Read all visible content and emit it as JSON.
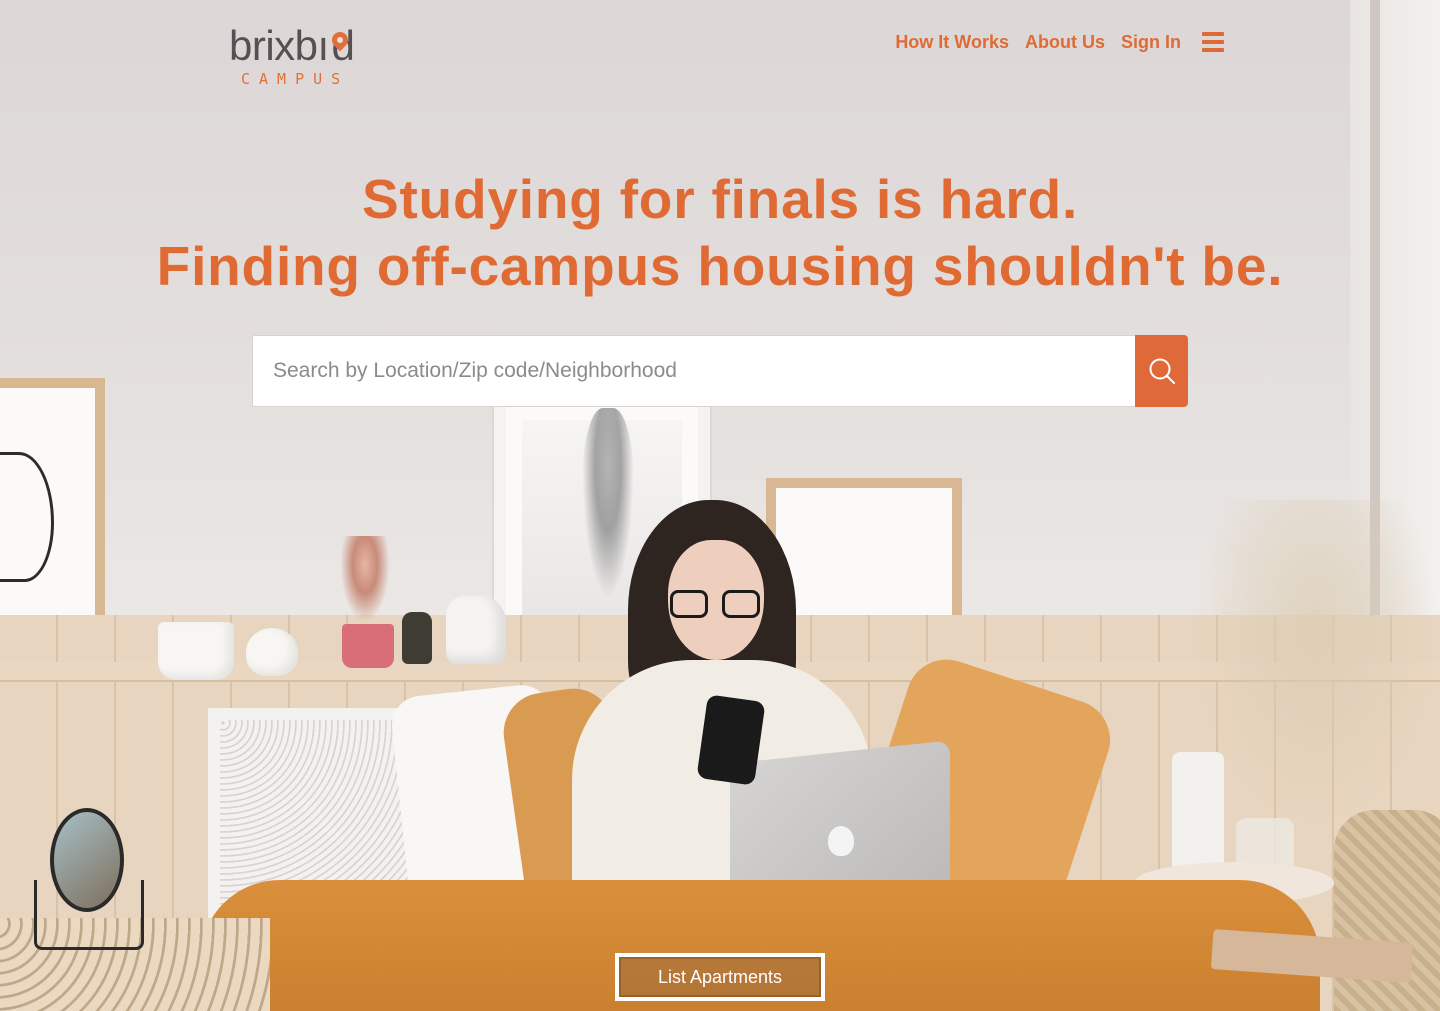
{
  "brand": {
    "name": "brixbid",
    "word_left": "brixb",
    "word_right": "d",
    "sub": "CAMPUS",
    "accent_color": "#e0703a",
    "text_color": "#555152"
  },
  "nav": {
    "items": [
      {
        "label": "How It Works"
      },
      {
        "label": "About Us"
      },
      {
        "label": "Sign In"
      }
    ],
    "menu_icon": "hamburger-menu-icon",
    "color": "#de6b36"
  },
  "hero": {
    "line1": "Studying for finals is hard.",
    "line2": "Finding off-campus housing shouldn't be.",
    "color": "#e06a33"
  },
  "search": {
    "placeholder": "Search by Location/Zip code/Neighborhood",
    "value": "",
    "button_icon": "search-icon",
    "button_color": "#e0693a"
  },
  "cta": {
    "label": "List Apartments"
  },
  "background": {
    "description_icon": "hero-photo"
  }
}
